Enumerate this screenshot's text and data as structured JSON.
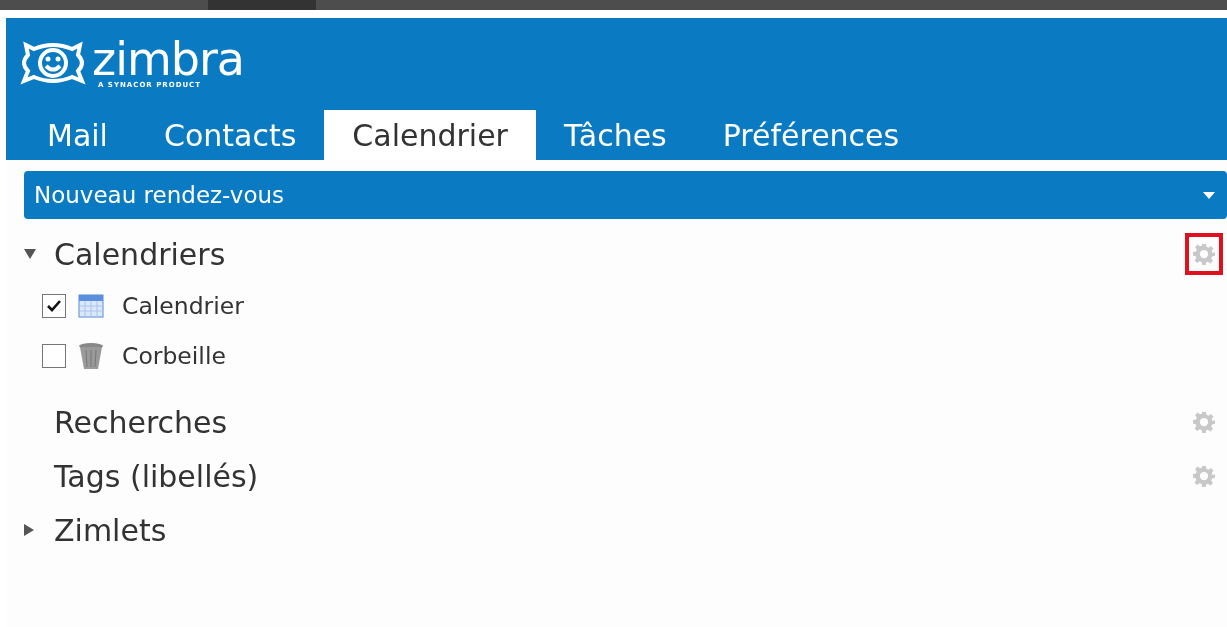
{
  "logo": {
    "name": "zimbra",
    "tagline": "A SYNACOR PRODUCT"
  },
  "tabs": [
    {
      "label": "Mail",
      "selected": false
    },
    {
      "label": "Contacts",
      "selected": false
    },
    {
      "label": "Calendrier",
      "selected": true
    },
    {
      "label": "Tâches",
      "selected": false
    },
    {
      "label": "Préférences",
      "selected": false
    }
  ],
  "new_button": {
    "label": "Nouveau rendez-vous"
  },
  "sections": [
    {
      "title": "Calendriers",
      "expanded": true,
      "gear": true,
      "highlighted": true,
      "items": [
        {
          "label": "Calendrier",
          "kind": "calendar",
          "checked": true
        },
        {
          "label": "Corbeille",
          "kind": "trash",
          "checked": false
        }
      ]
    },
    {
      "title": "Recherches",
      "gear": true,
      "highlighted": false
    },
    {
      "title": "Tags (libellés)",
      "gear": true,
      "highlighted": false
    },
    {
      "title": "Zimlets",
      "expanded": false
    }
  ]
}
